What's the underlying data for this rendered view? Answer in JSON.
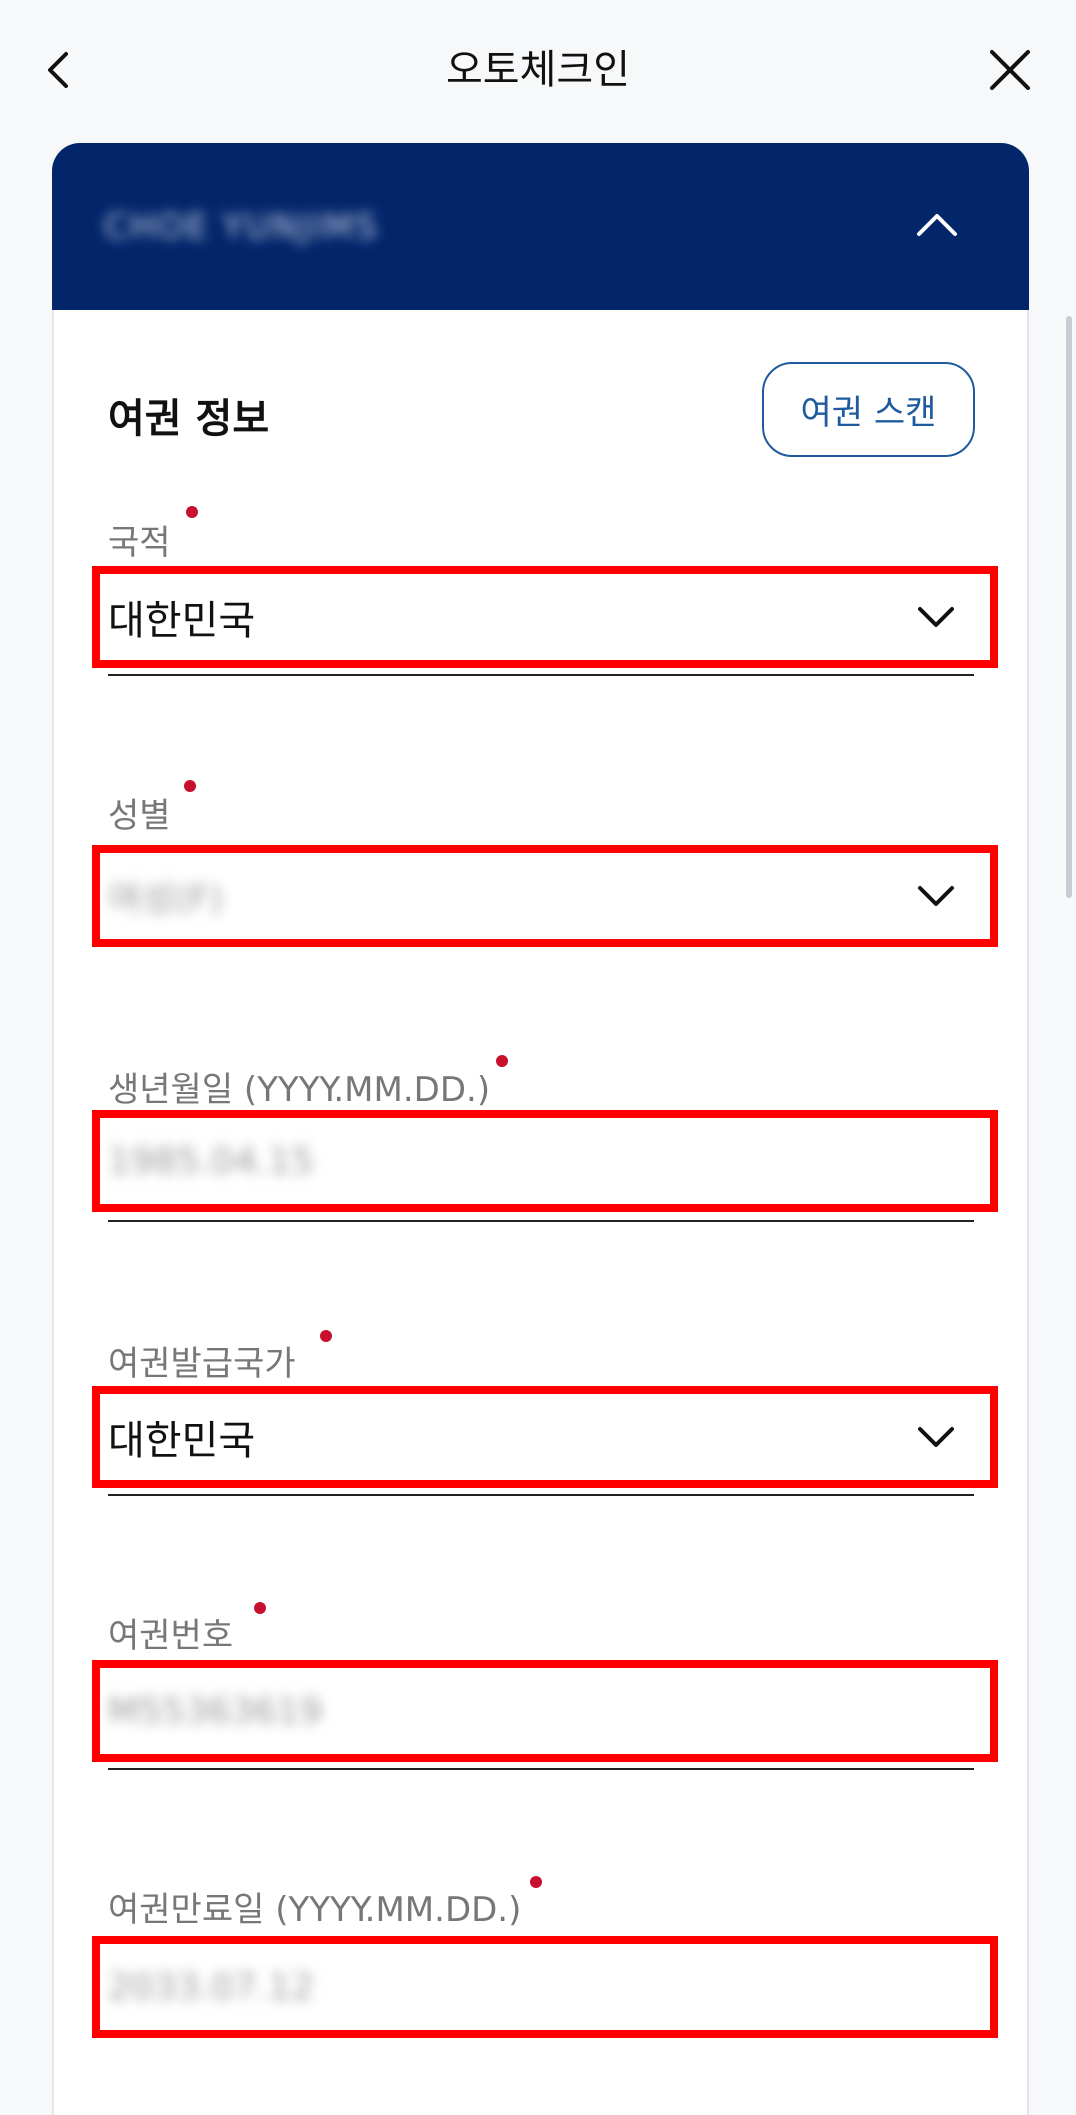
{
  "topbar": {
    "title": "오토체크인",
    "back_icon": "chevron-left-icon",
    "close_icon": "close-icon"
  },
  "card": {
    "passenger_name": "CHOE YUNJIMS",
    "collapse_icon": "chevron-up-icon",
    "header_color": "#03266b"
  },
  "section": {
    "title": "여권 정보",
    "scan_button_label": "여권 스캔"
  },
  "fields": {
    "nationality": {
      "label": "국적",
      "value": "대한민국",
      "type": "select"
    },
    "gender": {
      "label": "성별",
      "value": "여성(F)",
      "type": "select"
    },
    "birthdate": {
      "label": "생년월일 (YYYY.MM.DD.)",
      "value": "1985.04.15",
      "type": "input"
    },
    "issuing_country": {
      "label": "여권발급국가",
      "value": "대한민국",
      "type": "select"
    },
    "passport_number": {
      "label": "여권번호",
      "value": "M55363619",
      "type": "input"
    },
    "expiry_date": {
      "label": "여권만료일 (YYYY.MM.DD.)",
      "value": "2033.07.12",
      "type": "input"
    }
  },
  "colors": {
    "highlight": "#ff0000",
    "required_dot": "#c8102e",
    "link_blue": "#1f5a9e"
  }
}
